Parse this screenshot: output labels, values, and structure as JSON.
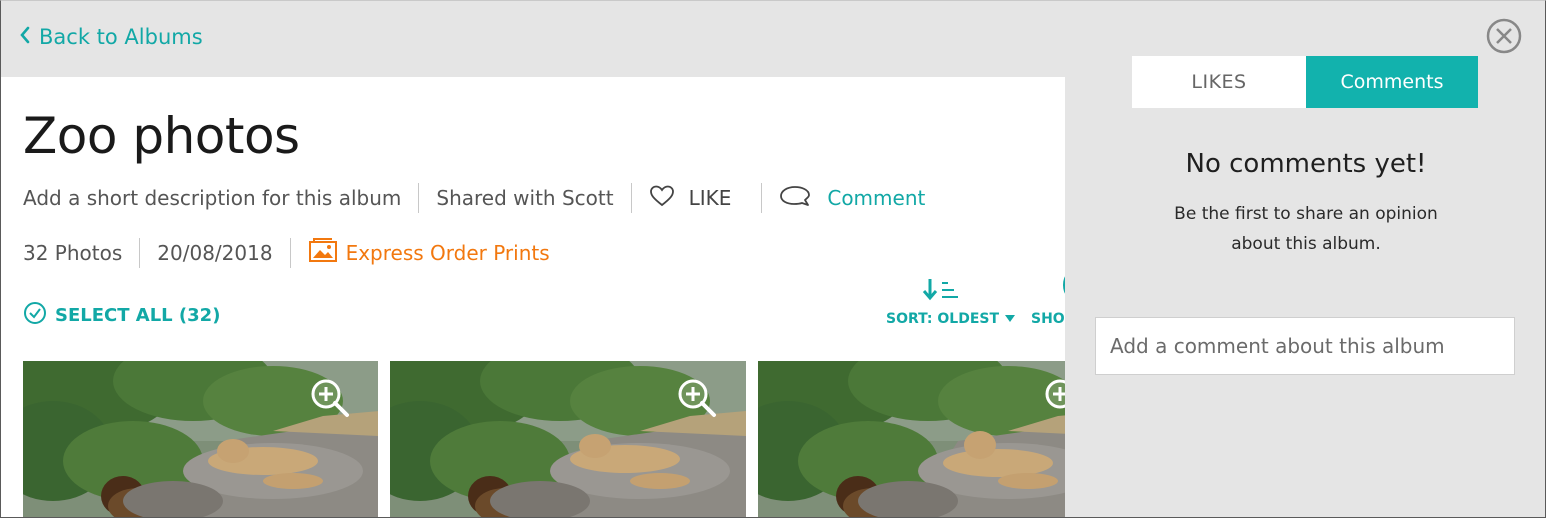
{
  "nav": {
    "back_label": "Back to Albums"
  },
  "album": {
    "title": "Zoo photos",
    "description_placeholder": "Add a short description for this album",
    "shared_with": "Shared with Scott",
    "like_label": "LIKE",
    "comment_label": "Comment",
    "photo_count": "32 Photos",
    "date": "20/08/2018",
    "express_label": "Express Order Prints"
  },
  "toolbar": {
    "select_all_label": "SELECT ALL (32)",
    "sort_label": "SORT: OLDEST",
    "show_label": "SHOW"
  },
  "panel": {
    "tabs": [
      {
        "label": "LIKES",
        "active": false
      },
      {
        "label": "Comments",
        "active": true
      }
    ],
    "empty_title": "No comments yet!",
    "empty_hint_line1": "Be the first to share an opinion",
    "empty_hint_line2": "about this album.",
    "input_placeholder": "Add a comment about this album"
  },
  "colors": {
    "accent": "#12a8a6",
    "accent_tab": "#12b2ad",
    "express": "#f2780f",
    "panel_bg": "#e5e5e5"
  },
  "icons": [
    "chevron-left-icon",
    "heart-icon",
    "speech-bubble-icon",
    "picture-icon",
    "check-circle-icon",
    "sort-icon",
    "dropdown-arrow-icon",
    "zoom-in-icon",
    "close-icon"
  ]
}
